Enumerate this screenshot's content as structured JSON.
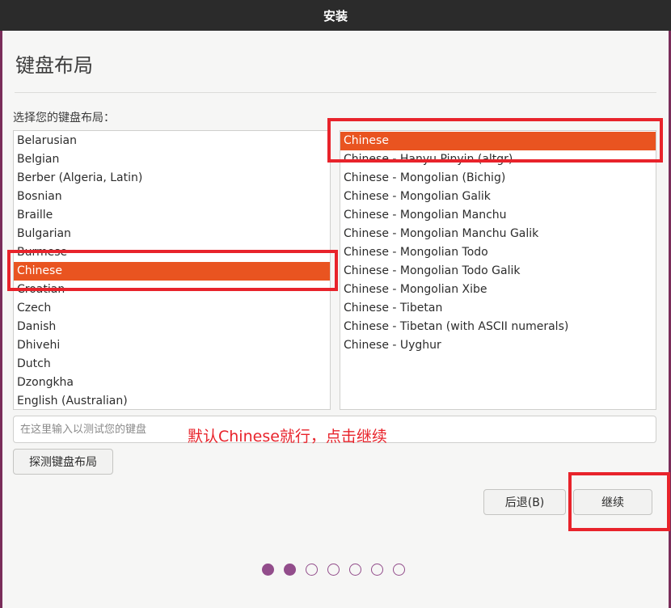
{
  "window": {
    "title": "安装"
  },
  "page": {
    "title": "键盘布局",
    "prompt": "选择您的键盘布局："
  },
  "layout_list": {
    "items": [
      "Belarusian",
      "Belgian",
      "Berber (Algeria, Latin)",
      "Bosnian",
      "Braille",
      "Bulgarian",
      "Burmese",
      "Chinese",
      "Croatian",
      "Czech",
      "Danish",
      "Dhivehi",
      "Dutch",
      "Dzongkha",
      "English (Australian)"
    ],
    "selected": "Chinese"
  },
  "variant_list": {
    "items": [
      "Chinese",
      "Chinese - Hanyu Pinyin (altgr)",
      "Chinese - Mongolian (Bichig)",
      "Chinese - Mongolian Galik",
      "Chinese - Mongolian Manchu",
      "Chinese - Mongolian Manchu Galik",
      "Chinese - Mongolian Todo",
      "Chinese - Mongolian Todo Galik",
      "Chinese - Mongolian Xibe",
      "Chinese - Tibetan",
      "Chinese - Tibetan (with ASCII numerals)",
      "Chinese - Uyghur"
    ],
    "selected": "Chinese"
  },
  "test_input": {
    "placeholder": "在这里输入以测试您的键盘",
    "value": ""
  },
  "annotation": {
    "text": "默认Chinese就行，点击继续"
  },
  "buttons": {
    "detect": "探测键盘布局",
    "back": "后退(B)",
    "continue": "继续"
  },
  "progress": {
    "total_steps": 7,
    "completed_steps": 2
  },
  "colors": {
    "selection": "#e95420",
    "annotation": "#e8232b",
    "progress_dot": "#924d8b",
    "titlebar": "#2b2b2b"
  }
}
